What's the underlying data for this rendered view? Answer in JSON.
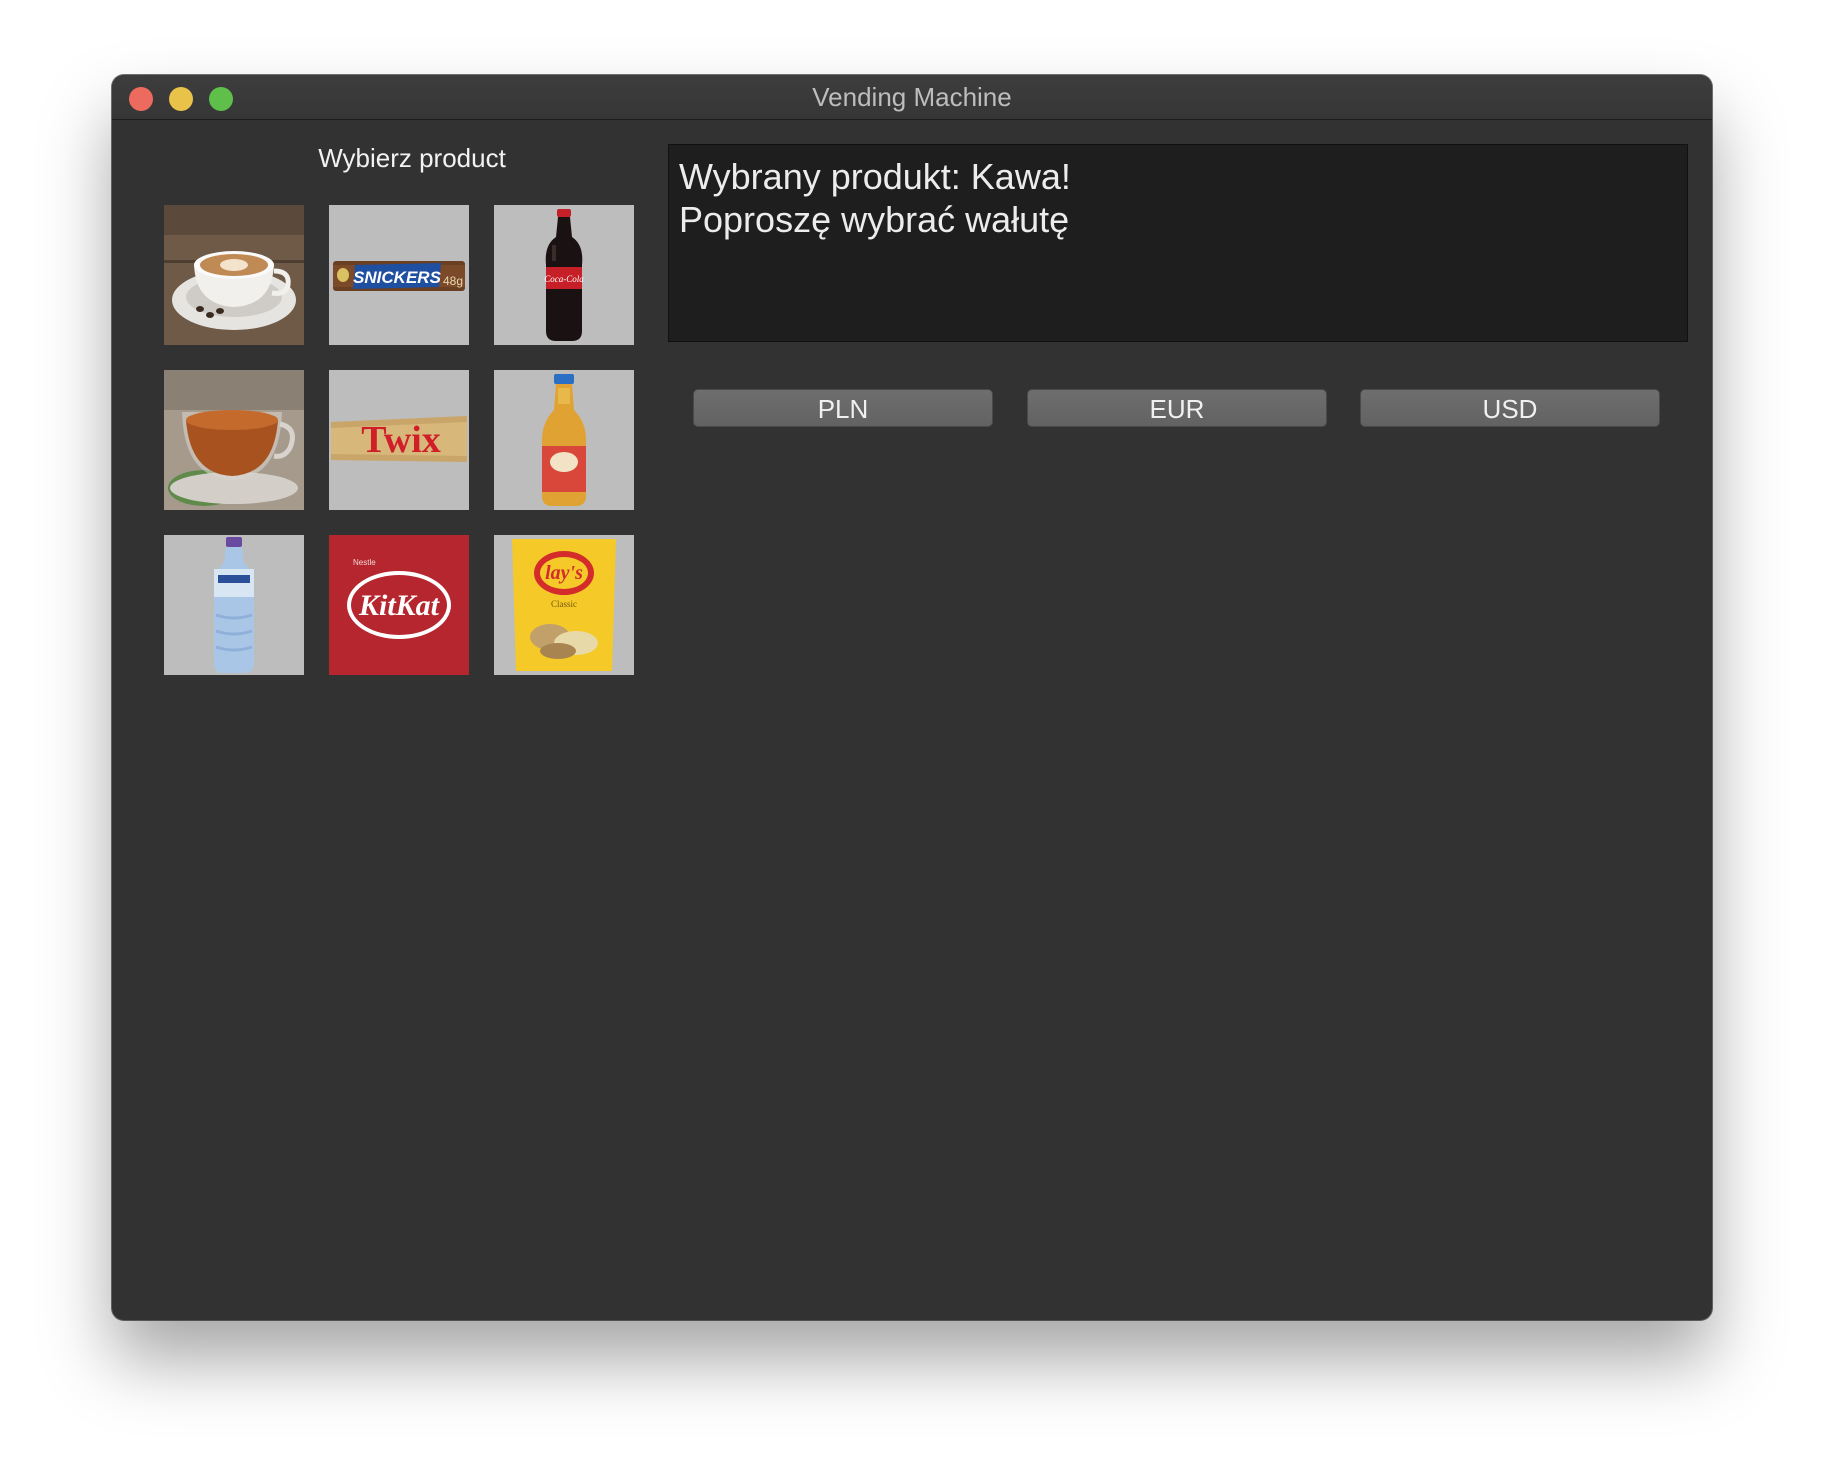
{
  "window": {
    "title": "Vending Machine"
  },
  "products": {
    "heading": "Wybierz product",
    "items": [
      {
        "name": "coffee",
        "icon": "coffee-cup-icon"
      },
      {
        "name": "snickers",
        "label": "SNICKERS",
        "weight": "48g",
        "icon": "snickers-bar-icon"
      },
      {
        "name": "coca-cola",
        "label": "Coca-Cola",
        "icon": "cola-bottle-icon"
      },
      {
        "name": "tea",
        "icon": "tea-cup-icon"
      },
      {
        "name": "twix",
        "label": "Twix",
        "icon": "twix-bar-icon"
      },
      {
        "name": "juice",
        "icon": "juice-bottle-icon"
      },
      {
        "name": "water",
        "icon": "water-bottle-icon"
      },
      {
        "name": "kitkat",
        "label": "KitKat",
        "brand": "Nestle",
        "icon": "kitkat-icon"
      },
      {
        "name": "lays",
        "label": "lay's",
        "sub": "Classic",
        "icon": "chips-bag-icon"
      }
    ]
  },
  "display": {
    "line1": "Wybrany produkt: Kawa!",
    "line2": "Poproszę wybrać wałutę"
  },
  "currencies": [
    "PLN",
    "EUR",
    "USD"
  ],
  "colors": {
    "window_bg": "#323232",
    "display_bg": "#1e1e1e",
    "button_bg": "#666666",
    "close": "#ed6a5e",
    "minimize": "#e9c249",
    "maximize": "#5fbf4b"
  }
}
